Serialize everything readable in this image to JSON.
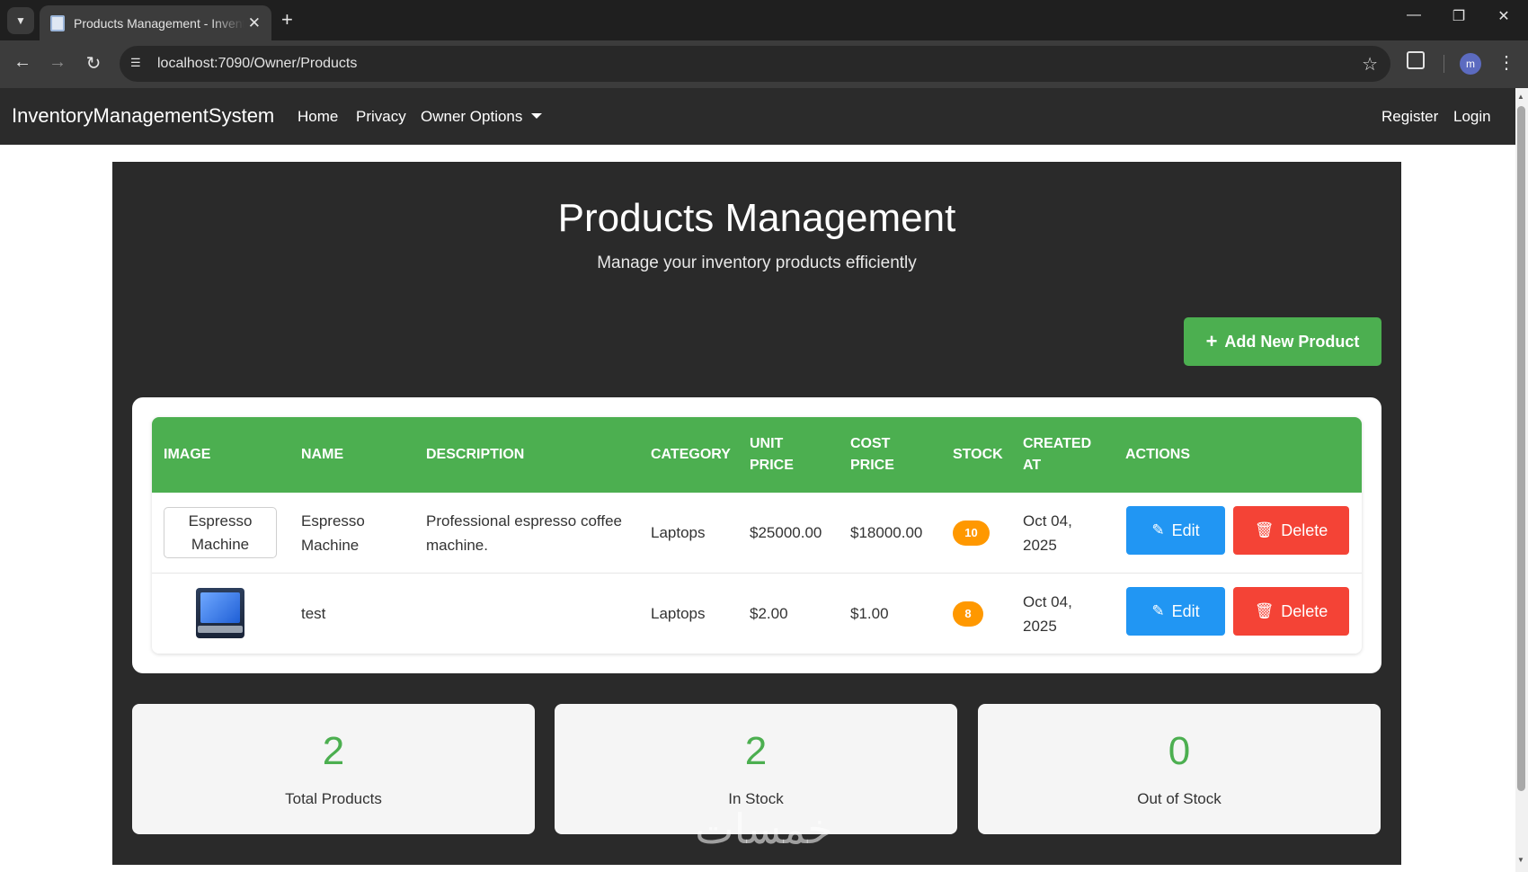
{
  "browser": {
    "tab_title": "Products Management - InventoryManagementSystem",
    "url": "localhost:7090/Owner/Products",
    "profile_initial": "m"
  },
  "navbar": {
    "brand": "InventoryManagementSystem",
    "links": [
      "Home",
      "Privacy",
      "Owner Options"
    ],
    "right_links": [
      "Register",
      "Login"
    ]
  },
  "page": {
    "title": "Products Management",
    "subtitle": "Manage your inventory products efficiently",
    "add_button": "Add New Product"
  },
  "table": {
    "headers": {
      "image": "IMAGE",
      "name": "NAME",
      "description": "DESCRIPTION",
      "category": "CATEGORY",
      "unit_price_1": "UNIT",
      "unit_price_2": "PRICE",
      "cost_price_1": "COST",
      "cost_price_2": "PRICE",
      "stock": "STOCK",
      "created_1": "CREATED",
      "created_2": "AT",
      "actions": "ACTIONS"
    },
    "rows": [
      {
        "image_alt_1": "Espresso",
        "image_alt_2": "Machine",
        "name_1": "Espresso",
        "name_2": "Machine",
        "description_1": "Professional espresso coffee",
        "description_2": "machine.",
        "category": "Laptops",
        "unit_price": "$25000.00",
        "cost_price": "$18000.00",
        "stock": "10",
        "created_1": "Oct 04,",
        "created_2": "2025",
        "edit": "Edit",
        "delete": "Delete"
      },
      {
        "name_1": "test",
        "category": "Laptops",
        "unit_price": "$2.00",
        "cost_price": "$1.00",
        "stock": "8",
        "created_1": "Oct 04,",
        "created_2": "2025",
        "edit": "Edit",
        "delete": "Delete"
      }
    ]
  },
  "stats": [
    {
      "value": "2",
      "label": "Total Products"
    },
    {
      "value": "2",
      "label": "In Stock"
    },
    {
      "value": "0",
      "label": "Out of Stock"
    }
  ],
  "watermark": "خمسات",
  "colors": {
    "accent_green": "#4caf50",
    "edit_blue": "#2196f3",
    "delete_red": "#f44336",
    "stock_badge": "#ff9800",
    "panel_dark": "#2a2a2a"
  }
}
